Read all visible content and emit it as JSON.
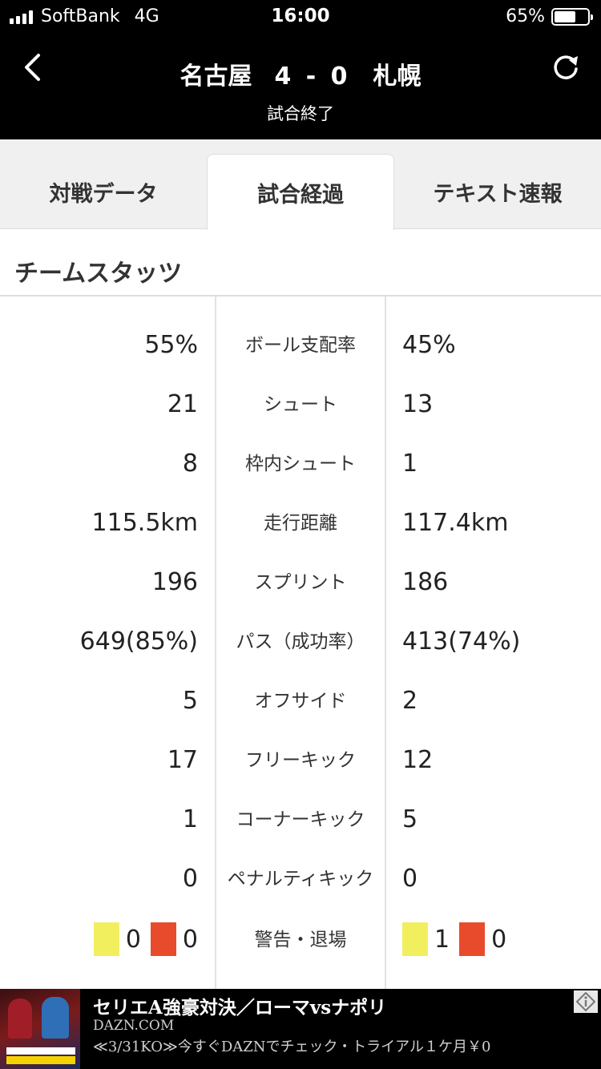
{
  "status_bar": {
    "carrier": "SoftBank",
    "network": "4G",
    "time": "16:00",
    "battery": "65%",
    "battery_level": 0.65
  },
  "header": {
    "home_team": "名古屋",
    "score": "4 - 0",
    "away_team": "札幌",
    "match_status": "試合終了",
    "icons": {
      "back": "chevron-left-icon",
      "reload": "reload-icon"
    }
  },
  "tabs": [
    {
      "label": "対戦データ",
      "active": false
    },
    {
      "label": "試合経過",
      "active": true
    },
    {
      "label": "テキスト速報",
      "active": false
    }
  ],
  "section": {
    "title": "チームスタッツ"
  },
  "stats": [
    {
      "home": "55%",
      "label": "ボール支配率",
      "away": "45%"
    },
    {
      "home": "21",
      "label": "シュート",
      "away": "13"
    },
    {
      "home": "8",
      "label": "枠内シュート",
      "away": "1"
    },
    {
      "home": "115.5km",
      "label": "走行距離",
      "away": "117.4km"
    },
    {
      "home": "196",
      "label": "スプリント",
      "away": "186"
    },
    {
      "home": "649(85%)",
      "label": "パス（成功率）",
      "away": "413(74%)"
    },
    {
      "home": "5",
      "label": "オフサイド",
      "away": "2"
    },
    {
      "home": "17",
      "label": "フリーキック",
      "away": "12"
    },
    {
      "home": "1",
      "label": "コーナーキック",
      "away": "5"
    },
    {
      "home": "0",
      "label": "ペナルティキック",
      "away": "0"
    }
  ],
  "cards": {
    "label": "警告・退場",
    "home": {
      "yellow": "0",
      "red": "0"
    },
    "away": {
      "yellow": "1",
      "red": "0"
    },
    "colors": {
      "yellow": "#f2ef5f",
      "red": "#e84b2b"
    }
  },
  "ad": {
    "title": "セリエA強豪対決／ローマvsナポリ",
    "domain": "DAZN.COM",
    "description": "≪3/31KO≫今すぐDAZNでチェック・トライアル１ケ月￥0"
  }
}
